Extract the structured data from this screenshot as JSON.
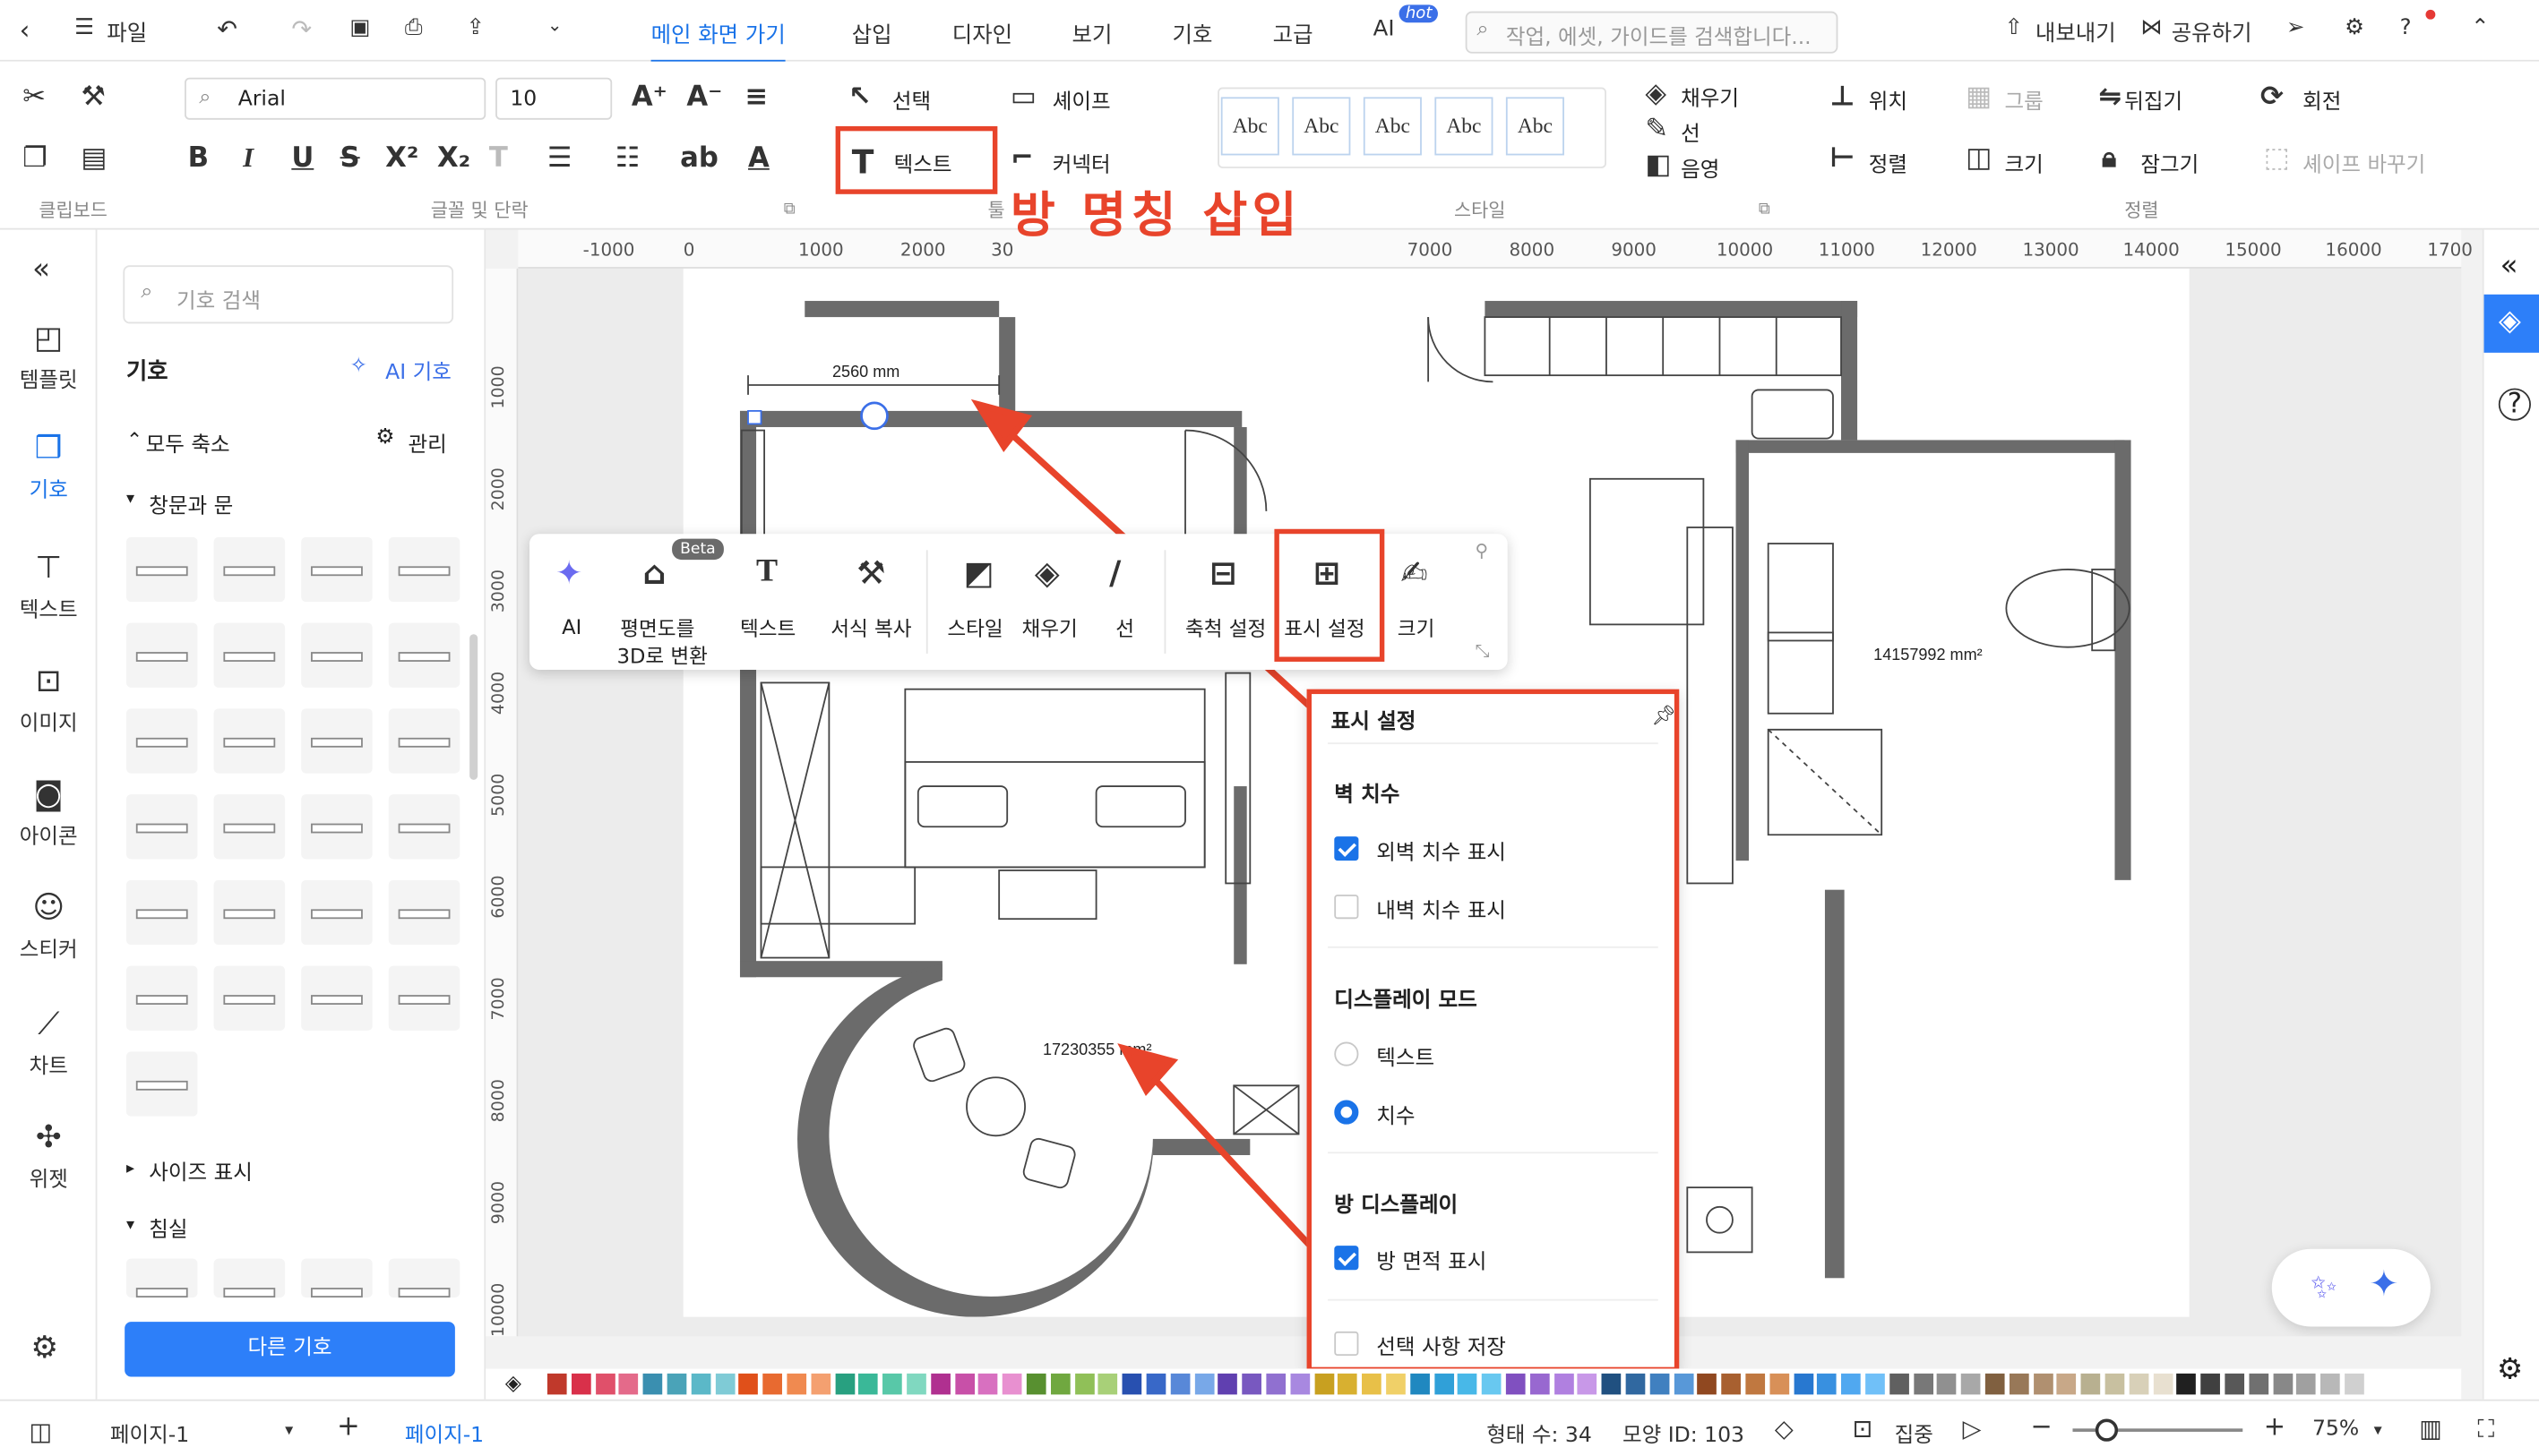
{
  "topbar": {
    "file_label": "파일",
    "tabs": [
      "메인 화면 가기",
      "삽입",
      "디자인",
      "보기",
      "기호",
      "고급",
      "AI"
    ],
    "hot_badge": "hot",
    "search_placeholder": "작업, 에셋, 가이드를 검색합니다...",
    "export_label": "내보내기",
    "share_label": "공유하기"
  },
  "ribbon": {
    "font_family": "Arial",
    "font_size": "10",
    "select_label": "선택",
    "shape_label": "셰이프",
    "text_label": "텍스트",
    "connector_label": "커넥터",
    "styles": [
      "Abc",
      "Abc",
      "Abc",
      "Abc",
      "Abc"
    ],
    "fill_label": "채우기",
    "line_label": "선",
    "shadow_label": "음영",
    "position_label": "위치",
    "group_label": "그룹",
    "flip_label": "뒤집기",
    "rotate_label": "회전",
    "align_label": "정렬",
    "size_label": "크기",
    "lock_label": "잠그기",
    "replace_shape_label": "셰이프 바꾸기",
    "groups": {
      "clipboard": "클립보드",
      "font_para": "글꼴 및 단락",
      "tools": "툴",
      "style": "스타일",
      "arrange": "정렬"
    }
  },
  "annotation": "방 명칭 삽입",
  "iconbar": [
    {
      "label": "템플릿",
      "icon": "template-icon"
    },
    {
      "label": "기호",
      "icon": "symbol-icon"
    },
    {
      "label": "텍스트",
      "icon": "text-icon"
    },
    {
      "label": "이미지",
      "icon": "image-icon"
    },
    {
      "label": "아이콘",
      "icon": "icon-icon"
    },
    {
      "label": "스티커",
      "icon": "sticker-icon"
    },
    {
      "label": "차트",
      "icon": "chart-icon"
    },
    {
      "label": "위젯",
      "icon": "widget-icon"
    }
  ],
  "symbols": {
    "search_placeholder": "기호 검색",
    "title": "기호",
    "ai_symbol": "AI 기호",
    "collapse_all": "모두 축소",
    "manage": "관리",
    "cat_windows_doors": "창문과 문",
    "cat_size": "사이즈 표시",
    "cat_bedroom": "침실",
    "more_button": "다른 기호"
  },
  "ruler_top": [
    "-1000",
    "0",
    "1000",
    "2000",
    "30",
    "7000",
    "8000",
    "9000",
    "10000",
    "11000",
    "12000",
    "13000",
    "14000",
    "15000",
    "16000",
    "1700"
  ],
  "ruler_left": [
    "1000",
    "2000",
    "3000",
    "4000",
    "5000",
    "6000",
    "7000",
    "8000",
    "9000",
    "10000"
  ],
  "floorplan": {
    "dimension": "2560 mm",
    "area_bath": "14157992 mm²",
    "area_living": "17230355 mm²"
  },
  "floating_toolbar": {
    "ai": "AI",
    "beta": "Beta",
    "to3d_line1": "평면도를",
    "to3d_line2": "3D로 변환",
    "text": "텍스트",
    "format_copy": "서식 복사",
    "style": "스타일",
    "fill": "채우기",
    "line": "선",
    "scale": "축척 설정",
    "display": "표시 설정",
    "size": "크기"
  },
  "display_settings": {
    "title": "표시 설정",
    "wall_dim": "벽 치수",
    "outer_dim": "외벽 치수 표시",
    "outer_dim_checked": true,
    "inner_dim": "내벽 치수 표시",
    "inner_dim_checked": false,
    "display_mode": "디스플레이 모드",
    "mode_text": "텍스트",
    "mode_dim": "치수",
    "mode_selected": "치수",
    "room_display": "방 디스플레이",
    "room_area": "방 면적 표시",
    "room_area_checked": true,
    "save_selection": "선택 사항 저장",
    "save_selection_checked": false
  },
  "status": {
    "page_select": "페이지-1",
    "page_tab": "페이지-1",
    "shape_count": "형태 수: 34",
    "shape_id": "모양 ID: 103",
    "focus": "집중",
    "zoom": "75%"
  },
  "colors": [
    "#c0392b",
    "#d9304a",
    "#e0506a",
    "#e46a8a",
    "#3a8fb0",
    "#4aa3b8",
    "#5bb8c8",
    "#7fcbd6",
    "#e0501a",
    "#e86a30",
    "#f08a50",
    "#f4a070",
    "#28a080",
    "#3ab898",
    "#58c8a8",
    "#80d8c0",
    "#b03090",
    "#c850a8",
    "#d870c0",
    "#e890d0",
    "#589030",
    "#70a840",
    "#90c058",
    "#a8d078",
    "#2850b0",
    "#3868c8",
    "#5888d8",
    "#78a8e8",
    "#6040b0",
    "#7858c0",
    "#9070d0",
    "#a888e0",
    "#c8a020",
    "#d8b030",
    "#e8c048",
    "#f0d068",
    "#2088c0",
    "#30a0d8",
    "#48b8e8",
    "#68c8f0",
    "#8050c0",
    "#9868d0",
    "#b080e0",
    "#c898e8",
    "#205080",
    "#3068a0",
    "#4080c0",
    "#5898d8",
    "#904820",
    "#a86030",
    "#c07840",
    "#d89058",
    "#2878d0",
    "#3890e0",
    "#50a8f0",
    "#70c0f8",
    "#606060",
    "#787878",
    "#909090",
    "#a8a8a8",
    "#806040",
    "#987858",
    "#b09070",
    "#c8a888",
    "#b8b090",
    "#c8c0a0",
    "#d8d0b8",
    "#e8e0d0",
    "#202020",
    "#404040",
    "#585858",
    "#707070",
    "#888888",
    "#a0a0a0",
    "#b8b8b8",
    "#d0d0d0"
  ]
}
